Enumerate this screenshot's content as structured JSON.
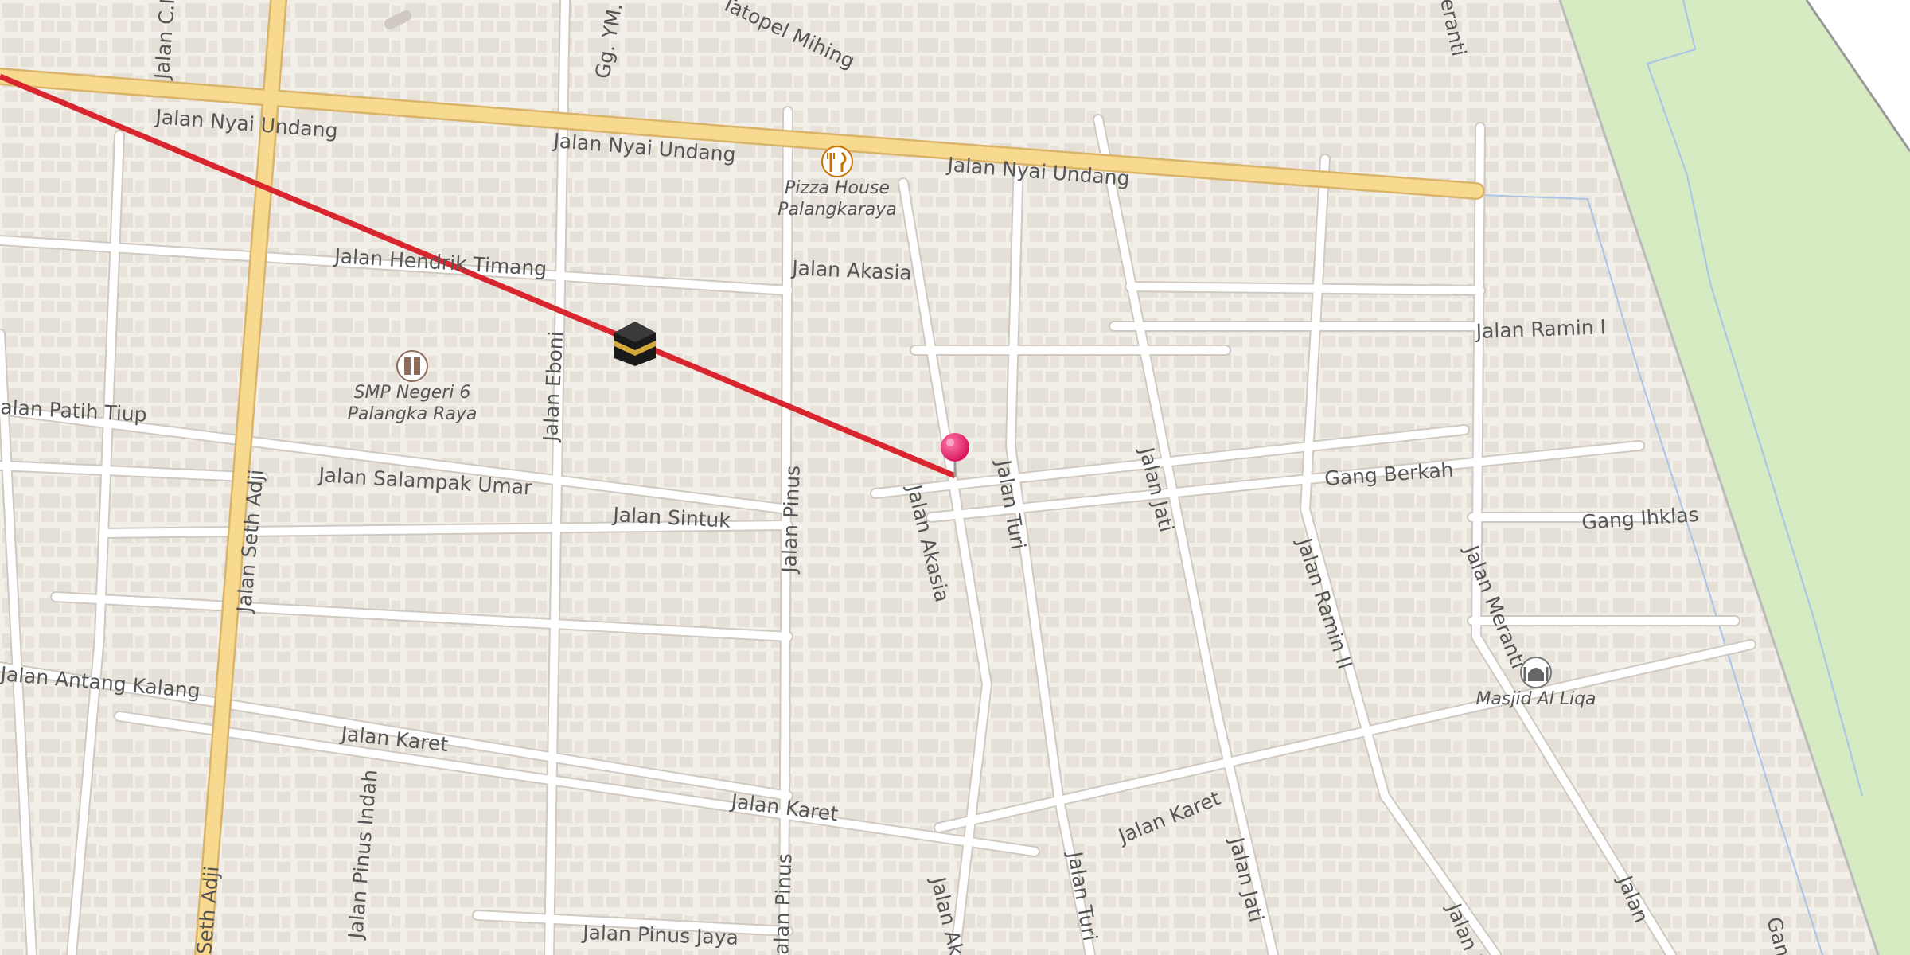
{
  "map": {
    "streets": {
      "nyai_undang_1": "Jalan Nyai Undang",
      "nyai_undang_2": "Jalan Nyai Undang",
      "nyai_undang_3": "Jalan Nyai Undang",
      "hendrik_timang": "Jalan Hendrik Timang",
      "akasia_h": "Jalan Akasia",
      "ramin_i": "Jalan Ramin I",
      "patih_tiup": "alan Patih Tiup",
      "salampak_umar": "Jalan Salampak Umar",
      "sintuk": "Jalan Sintuk",
      "gang_berkah": "Gang Berkah",
      "gang_ihklas": "Gang Ihklas",
      "antang_kalang": "Jalan Antang Kalang",
      "karet_1": "Jalan Karet",
      "karet_2": "Jalan Karet",
      "karet_3": "Jalan Karet",
      "pinus_jaya": "Jalan Pinus Jaya",
      "seth_adji_1": "Jalan Seth Adji",
      "seth_adji_2": "Seth Adji",
      "eboni": "Jalan Eboni",
      "pinus_1": "Jalan Pinus",
      "pinus_2": "alan Pinus",
      "akasia_v1": "Jalan Akasia",
      "akasia_v2": "Jalan Ak",
      "turi_1": "Jalan Turi",
      "turi_2": "Jalan Turi",
      "jati_1": "Jalan Jati",
      "jati_2": "Jalan Jati",
      "ramin_ii": "Jalan Ramin II",
      "meranti_1": "Jalan Meranti",
      "meranti_top": "eranti",
      "meranti_bottom": "Jalan M",
      "pinus_indah": "Jalan Pinus Indah",
      "jalan_c": "Jalan C.M",
      "gg_ym": "Gg. YM.",
      "mihing": "Tatopel Mihing",
      "bottom_j": "Jalan",
      "bottom_gan": "Gan"
    },
    "pois": {
      "pizza_line1": "Pizza House",
      "pizza_line2": "Palangkaraya",
      "school_line1": "SMP Negeri 6",
      "school_line2": "Palangka Raya",
      "mosque": "Masjid Al Liqa"
    },
    "icons": {
      "restaurant": "restaurant-icon",
      "school": "school-icon",
      "mosque": "mosque-icon",
      "kaaba": "kaaba-icon",
      "pin": "location-pin-icon"
    },
    "colors": {
      "background": "#f2efe9",
      "building": "#e5dfd7",
      "main_road": "#f7d98f",
      "qibla_line": "#d9262e",
      "park": "#d6ebc2",
      "pin": "#e91e63"
    }
  }
}
